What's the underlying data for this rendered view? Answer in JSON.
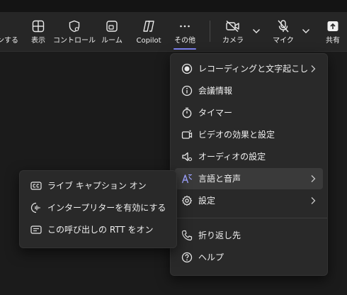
{
  "toolbar": {
    "items": [
      {
        "label": "ンする",
        "icon": "hand-icon-partial"
      },
      {
        "label": "表示",
        "icon": "grid-view-icon"
      },
      {
        "label": "コントロール",
        "icon": "shield-control-icon"
      },
      {
        "label": "ルーム",
        "icon": "room-icon"
      },
      {
        "label": "Copilot",
        "icon": "copilot-icon"
      },
      {
        "label": "その他",
        "icon": "more-icon",
        "active": true
      },
      {
        "label": "カメラ",
        "icon": "camera-off-icon"
      },
      {
        "label": "マイク",
        "icon": "mic-off-icon"
      },
      {
        "label": "共有",
        "icon": "share-icon"
      }
    ],
    "accent_color": "#7f85f5"
  },
  "more_menu": {
    "items": [
      {
        "label": "レコーディングと文字起こし",
        "icon": "record-icon",
        "has_submenu": true
      },
      {
        "label": "会議情報",
        "icon": "info-icon",
        "has_submenu": false
      },
      {
        "label": "タイマー",
        "icon": "timer-icon",
        "has_submenu": false
      },
      {
        "label": "ビデオの効果と設定",
        "icon": "video-effects-icon",
        "has_submenu": false
      },
      {
        "label": "オーディオの設定",
        "icon": "speaker-icon",
        "has_submenu": false
      },
      {
        "label": "言語と音声",
        "icon": "language-icon",
        "has_submenu": true,
        "highlighted": true
      },
      {
        "label": "設定",
        "icon": "settings-gear-icon",
        "has_submenu": true
      },
      {
        "label": "折り返し先",
        "icon": "phone-callback-icon",
        "has_submenu": false
      },
      {
        "label": "ヘルプ",
        "icon": "help-icon",
        "has_submenu": false
      }
    ]
  },
  "language_submenu": {
    "items": [
      {
        "label": "ライブ キャプション オン",
        "icon": "closed-caption-icon"
      },
      {
        "label": "インタープリターを有効にする",
        "icon": "interpreter-icon"
      },
      {
        "label": "この呼び出しの RTT をオン",
        "icon": "rtt-icon"
      }
    ]
  }
}
